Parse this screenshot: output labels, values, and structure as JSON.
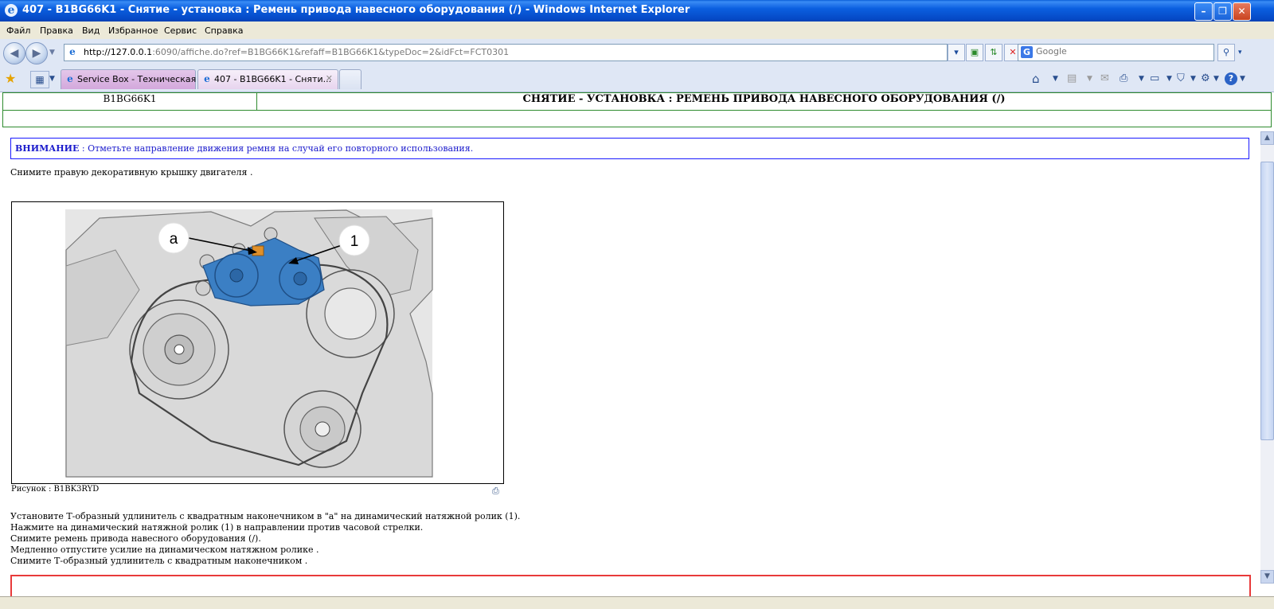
{
  "window": {
    "title": "407 - B1BG66K1 - Снятие - установка : Ремень привода навесного оборудования (/) - Windows Internet Explorer",
    "minimize": "–",
    "restore": "❐",
    "close": "✕"
  },
  "menu": [
    "Файл",
    "Правка",
    "Вид",
    "Избранное",
    "Сервис",
    "Справка"
  ],
  "address": {
    "url_host": "http://127.0.0.1",
    "url_rest": ":6090/affiche.do?ref=B1BG66K1&refaff=B1BG66K1&typeDoc=2&idFct=FCT0301"
  },
  "search": {
    "placeholder": "Google",
    "engine_letter": "G"
  },
  "tabs": [
    {
      "label": "Service Box - Техническая ...",
      "active": false
    },
    {
      "label": "407 - B1BG66K1 - Сняти...",
      "active": true,
      "close": "✕"
    }
  ],
  "page": {
    "code": "B1BG66K1",
    "heading": "СНЯТИЕ - УСТАНОВКА : РЕМЕНЬ ПРИВОДА НАВЕСНОГО ОБОРУДОВАНИЯ (/)",
    "warning_label": "ВНИМАНИЕ",
    "warning_text": " : Отметьте направление движения ремня на случай его повторного использования.",
    "step1": "Снимите правую декоративную крышку двигателя .",
    "figure": {
      "callout_a": "a",
      "callout_1": "1",
      "caption": "Рисунок : B1BK3RYD"
    },
    "steps": [
      "Установите Т-образный удлинитель с квадратным наконечником в \"а\" на динамический натяжной ролик (1).",
      "Нажмите на динамический натяжной ролик (1) в направлении против часовой стрелки.",
      "Снимите ремень привода навесного оборудования (/).",
      "Медленно отпустите усилие на динамическом натяжном ролике .",
      "Снимите Т-образный удлинитель с квадратным наконечником ."
    ]
  },
  "colors": {
    "titlebar": "#0b5fe0",
    "header_border": "#2e8b2e",
    "warning_border": "#1a1aff",
    "warning_text": "#1a1acc",
    "bottom_box_border": "#e83a3a",
    "tensioner_blue": "#3b7fc4",
    "callout_orange": "#e0902a"
  },
  "icons": {
    "back": "back-arrow-icon",
    "forward": "forward-arrow-icon",
    "refresh": "refresh-icon",
    "stop": "stop-icon",
    "favorites": "star-icon",
    "home": "home-icon",
    "rss": "rss-icon",
    "mail": "mail-icon",
    "print": "printer-icon",
    "page": "page-icon",
    "safety": "shield-icon",
    "tools": "gear-icon",
    "help": "help-icon"
  }
}
